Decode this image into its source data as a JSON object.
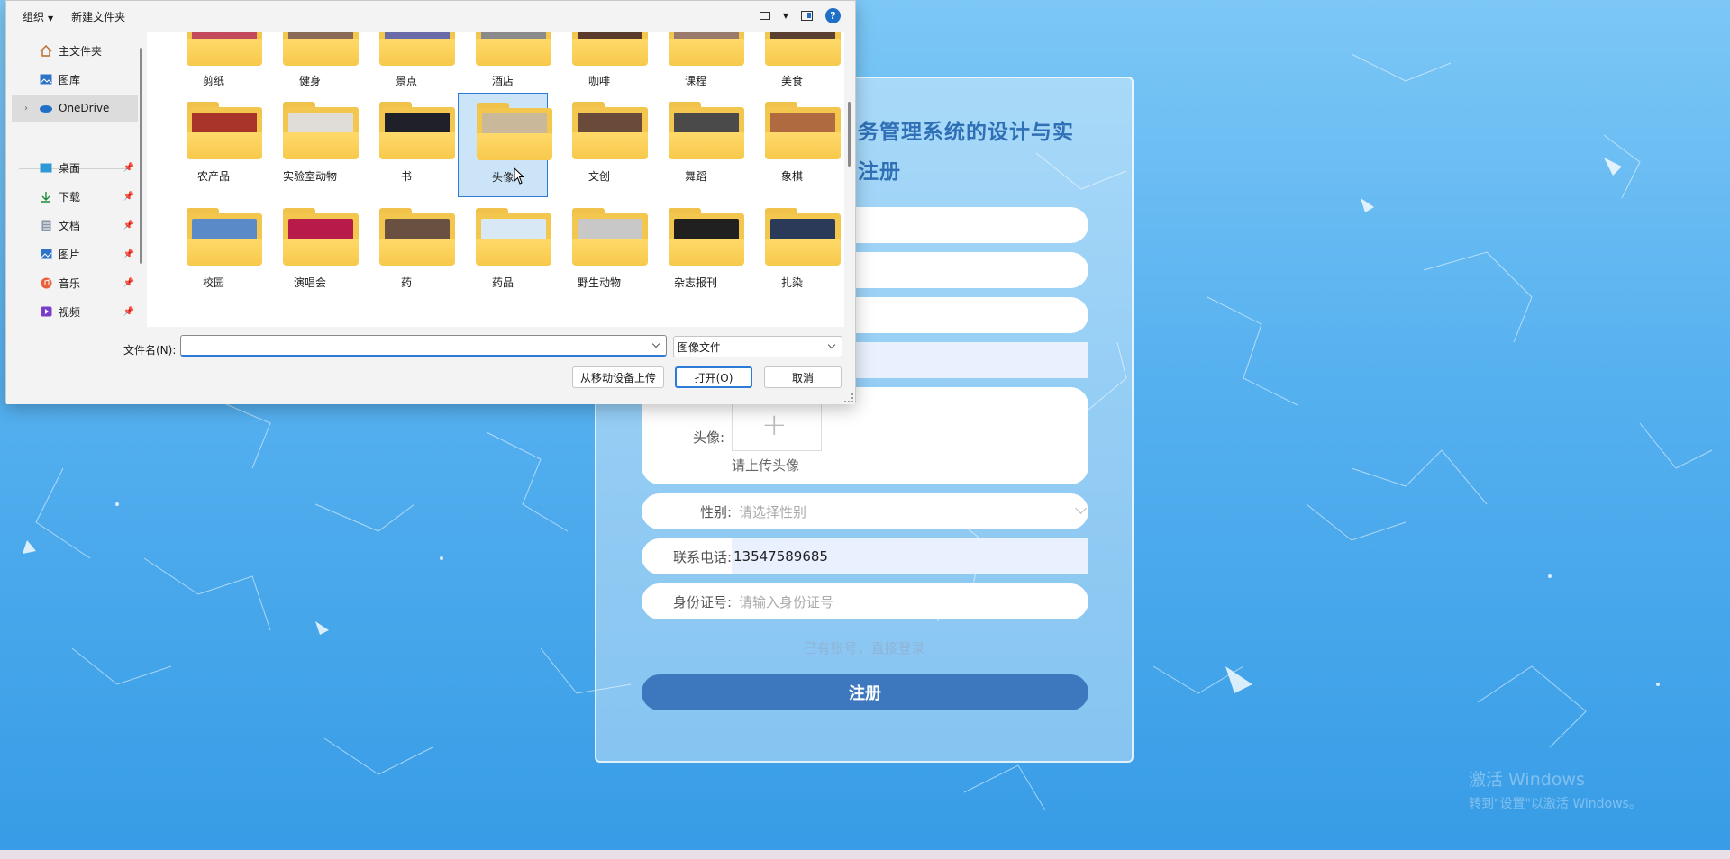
{
  "register": {
    "title_line1": "务管理系统的设计与实",
    "title_line2": "注册",
    "avatar_label": "头像:",
    "avatar_hint": "请上传头像",
    "gender_label": "性别:",
    "gender_placeholder": "请选择性别",
    "phone_label": "联系电话:",
    "phone_value": "13547589685",
    "idcard_label": "身份证号:",
    "idcard_placeholder": "请输入身份证号",
    "login_link": "已有账号，直接登录",
    "register_button": "注册"
  },
  "watermark": {
    "line1": "激活 Windows",
    "line2": "转到\"设置\"以激活 Windows。"
  },
  "dialog": {
    "toolbar": {
      "organize": "组织",
      "new_folder": "新建文件夹"
    },
    "nav": [
      {
        "label": "主文件夹",
        "icon": "home-icon"
      },
      {
        "label": "图库",
        "icon": "gallery-icon"
      },
      {
        "label": "OneDrive",
        "icon": "cloud-icon"
      },
      {
        "label": "桌面",
        "icon": "desktop-icon"
      },
      {
        "label": "下载",
        "icon": "download-icon"
      },
      {
        "label": "文档",
        "icon": "document-icon"
      },
      {
        "label": "图片",
        "icon": "picture-icon"
      },
      {
        "label": "音乐",
        "icon": "music-icon"
      },
      {
        "label": "视频",
        "icon": "video-icon"
      }
    ],
    "folders_row1": [
      "剪纸",
      "健身",
      "景点",
      "酒店",
      "咖啡",
      "课程",
      "美食"
    ],
    "folders_row2": [
      "农产品",
      "实验室动物",
      "书",
      "头像",
      "文创",
      "舞蹈",
      "象棋"
    ],
    "folders_row3": [
      "校园",
      "演唱会",
      "药",
      "药品",
      "野生动物",
      "杂志报刊",
      "扎染"
    ],
    "selected_folder": "头像",
    "filename_label": "文件名(N):",
    "filename_value": "",
    "filetype": "图像文件",
    "upload_mobile": "从移动设备上传",
    "open": "打开(O)",
    "cancel": "取消"
  },
  "colors": {
    "accent": "#3d78bf",
    "title": "#2f6fb6",
    "dialog_select": "#cce4f7"
  }
}
